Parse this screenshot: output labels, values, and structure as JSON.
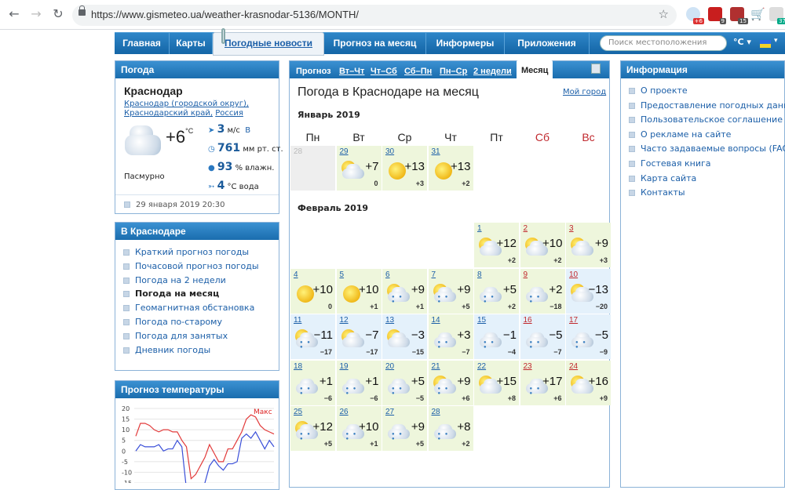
{
  "browser": {
    "url": "https://www.gismeteo.ua/weather-krasnodar-5136/MONTH/",
    "ext_badges": [
      "+6",
      "9",
      "15",
      "37"
    ]
  },
  "nav": {
    "items": [
      "Главная",
      "Карты",
      "Погодные новости",
      "Прогноз на месяц",
      "Информеры",
      "Приложения"
    ],
    "search_placeholder": "Поиск местоположения",
    "unit": "°C ▾",
    "flag_caret": "▾"
  },
  "weather_panel": {
    "title": "Погода",
    "city": "Краснодар",
    "breadcrumbs": [
      "Краснодар (городской округ),",
      "Краснодарский край,",
      "Россия"
    ],
    "temp": "+6",
    "temp_unit": "°C",
    "condition": "Пасмурно",
    "wind_val": "3",
    "wind_unit": "м/с",
    "wind_dir": "В",
    "pressure_val": "761",
    "pressure_unit": "мм рт. ст.",
    "humidity_val": "93",
    "humidity_unit": "% влажн.",
    "water_val": "4",
    "water_unit": "°C вода",
    "timestamp": "29 января 2019 20:30"
  },
  "city_panel": {
    "title": "В Краснодаре",
    "links": [
      "Краткий прогноз погоды",
      "Почасовой прогноз погоды",
      "Погода на 2 недели",
      "Погода на месяц",
      "Геомагнитная обстановка",
      "Погода по-старому",
      "Погода для занятых",
      "Дневник погоды"
    ],
    "current_index": 3
  },
  "temp_panel": {
    "title": "Прогноз температуры",
    "max_label": "Макс",
    "y_ticks": [
      "20",
      "15",
      "10",
      "5",
      "0",
      "-5",
      "-10",
      "-15"
    ]
  },
  "forecast": {
    "tabs_label": "Прогноз",
    "tabs": [
      "Вт–Чт",
      "Чт–Сб",
      "Сб–Пн",
      "Пн–Ср",
      "2 недели",
      "Месяц"
    ],
    "title": "Погода в Краснодаре на месяц",
    "my_city": "Мой город",
    "jan_title": "Январь 2019",
    "feb_title": "Февраль 2019",
    "weekdays": [
      "Пн",
      "Вт",
      "Ср",
      "Чт",
      "Пт",
      "Сб",
      "Вс"
    ],
    "jan_days": [
      {
        "d": "28",
        "t": "",
        "w": "",
        "icon": "none"
      },
      {
        "d": "29",
        "t": "+7",
        "w": "0",
        "icon": "cloud-sun"
      },
      {
        "d": "30",
        "t": "+13",
        "w": "+3",
        "icon": "sun"
      },
      {
        "d": "31",
        "t": "+13",
        "w": "+2",
        "icon": "sun"
      }
    ],
    "feb_days": [
      {
        "d": "1",
        "t": "+12",
        "w": "+2",
        "icon": "cloud-sun"
      },
      {
        "d": "2",
        "t": "+10",
        "w": "+2",
        "icon": "cloud-sun"
      },
      {
        "d": "3",
        "t": "+9",
        "w": "+3",
        "icon": "cloud-sun"
      },
      {
        "d": "4",
        "t": "+10",
        "w": "0",
        "icon": "sun"
      },
      {
        "d": "5",
        "t": "+10",
        "w": "+1",
        "icon": "sun"
      },
      {
        "d": "6",
        "t": "+9",
        "w": "+1",
        "icon": "cloud-sun-rain"
      },
      {
        "d": "7",
        "t": "+9",
        "w": "+5",
        "icon": "cloud-sun-rain"
      },
      {
        "d": "8",
        "t": "+5",
        "w": "+2",
        "icon": "cloud-rain"
      },
      {
        "d": "9",
        "t": "+2",
        "w": "−18",
        "icon": "cloud-rain"
      },
      {
        "d": "10",
        "t": "−13",
        "w": "−20",
        "icon": "cloud-sun"
      },
      {
        "d": "11",
        "t": "−11",
        "w": "−17",
        "icon": "cloud-sun-rain"
      },
      {
        "d": "12",
        "t": "−7",
        "w": "−17",
        "icon": "cloud-sun"
      },
      {
        "d": "13",
        "t": "−3",
        "w": "−15",
        "icon": "cloud-sun"
      },
      {
        "d": "14",
        "t": "+3",
        "w": "−7",
        "icon": "cloud-rain"
      },
      {
        "d": "15",
        "t": "−1",
        "w": "−4",
        "icon": "cloud-rain"
      },
      {
        "d": "16",
        "t": "−5",
        "w": "−7",
        "icon": "cloud-rain"
      },
      {
        "d": "17",
        "t": "−5",
        "w": "−9",
        "icon": "cloud-rain"
      },
      {
        "d": "18",
        "t": "+1",
        "w": "−6",
        "icon": "cloud-rain"
      },
      {
        "d": "19",
        "t": "+1",
        "w": "−6",
        "icon": "cloud-rain"
      },
      {
        "d": "20",
        "t": "+5",
        "w": "−5",
        "icon": "cloud-rain"
      },
      {
        "d": "21",
        "t": "+9",
        "w": "+6",
        "icon": "cloud-sun-rain"
      },
      {
        "d": "22",
        "t": "+15",
        "w": "+8",
        "icon": "cloud-sun"
      },
      {
        "d": "23",
        "t": "+17",
        "w": "+6",
        "icon": "cloud-rain"
      },
      {
        "d": "24",
        "t": "+16",
        "w": "+9",
        "icon": "cloud-sun"
      },
      {
        "d": "25",
        "t": "+12",
        "w": "+5",
        "icon": "cloud-sun-rain"
      },
      {
        "d": "26",
        "t": "+10",
        "w": "+1",
        "icon": "cloud-rain"
      },
      {
        "d": "27",
        "t": "+9",
        "w": "+5",
        "icon": "cloud-rain"
      },
      {
        "d": "28",
        "t": "+8",
        "w": "+2",
        "icon": "cloud-rain"
      }
    ]
  },
  "info_panel": {
    "title": "Информация",
    "links": [
      "О проекте",
      "Предоставление погодных данных",
      "Пользовательское соглашение",
      "О рекламе на сайте",
      "Часто задаваемые вопросы (FAQ)",
      "Гостевая книга",
      "Карта сайта",
      "Контакты"
    ]
  },
  "colors": {
    "accent": "#1a6dae",
    "weekend": "#c0282d",
    "cell_warm": "#eef6dc",
    "cell_cold": "#e4f1fb",
    "cell_past": "#eeeeee"
  }
}
